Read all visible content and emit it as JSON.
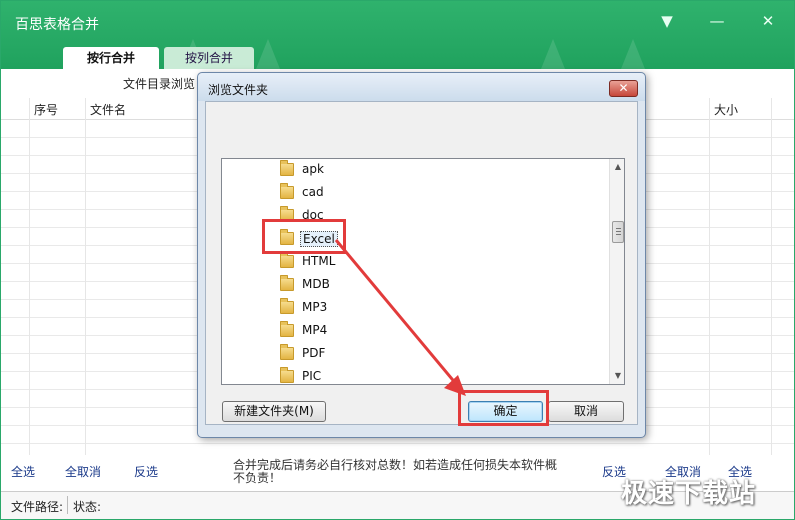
{
  "app": {
    "title": "百思表格合并",
    "window_controls": {
      "menu": "▼",
      "minimize": "—",
      "close": "✕"
    },
    "tabs": [
      {
        "label": "按行合并",
        "active": true
      },
      {
        "label": "按列合并",
        "active": false
      }
    ],
    "toolbar_label": "文件目录浏览",
    "columns": {
      "index": "序号",
      "filename": "文件名",
      "size": "大小"
    },
    "bottom": {
      "left": {
        "select_all": "全选",
        "deselect_all": "全取消",
        "invert": "反选"
      },
      "notice": "合并完成后请务必自行核对总数！如若造成任何损失本软件概不负责！",
      "right": {
        "invert": "反选",
        "deselect_all": "全取消",
        "select_all": "全选"
      }
    },
    "status": {
      "file_path_label": "文件路径:",
      "status_label": "状态:"
    },
    "watermark": "极速下载站"
  },
  "dialog": {
    "title": "浏览文件夹",
    "close_symbol": "✕",
    "folders": [
      "apk",
      "cad",
      "doc",
      "Excel",
      "HTML",
      "MDB",
      "MP3",
      "MP4",
      "PDF",
      "PIC"
    ],
    "selected_folder": "Excel",
    "new_folder_button": "新建文件夹(M)",
    "ok_button": "确定",
    "cancel_button": "取消"
  },
  "colors": {
    "brand_green": "#20a25e",
    "annotation_red": "#e23b3b"
  }
}
